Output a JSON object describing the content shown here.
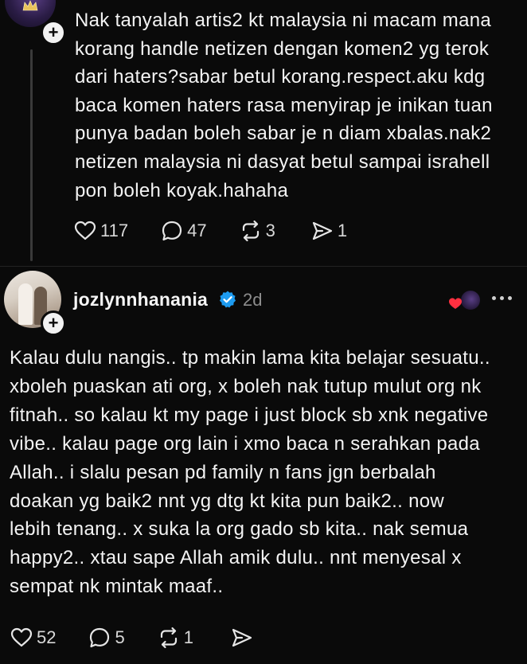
{
  "post1": {
    "text": "Nak tanyalah artis2 kt malaysia ni macam mana\nkorang handle netizen dengan komen2 yg terok\ndari haters?sabar betul korang.respect.aku kdg\nbaca komen haters rasa menyirap je inikan tuan\npunya badan boleh sabar je n diam xbalas.nak2\nnetizen malaysia ni dasyat betul sampai israhell\npon boleh koyak.hahaha",
    "likes": "117",
    "replies": "47",
    "reposts": "3",
    "shares": "1"
  },
  "post2": {
    "username": "jozlynnhanania",
    "time": "2d",
    "text": "Kalau dulu nangis.. tp makin lama kita belajar sesuatu..\nxboleh puaskan ati org, x boleh nak tutup mulut org nk\nfitnah.. so kalau kt my page i just block sb xnk negative\nvibe.. kalau page org lain i xmo baca n serahkan pada\nAllah.. i slalu pesan pd family n fans jgn berbalah\ndoakan yg baik2 nnt yg dtg kt kita pun baik2.. now\nlebih tenang.. x suka la org gado sb kita.. nak semua\nhappy2.. xtau sape Allah amik dulu.. nnt menyesal x\nsempat nk mintak maaf..",
    "likes": "52",
    "replies": "5",
    "reposts": "1"
  },
  "icons": {
    "like": "heart-icon",
    "reply": "comment-icon",
    "repost": "repost-icon",
    "share": "send-icon",
    "follow": "plus-icon",
    "verified": "verified-badge-icon",
    "more": "more-icon"
  },
  "colors": {
    "background": "#0a0a0a",
    "text": "#f3f3f3",
    "muted": "#8d8d8d",
    "verified": "#1d9bf0",
    "heart": "#ff3040"
  }
}
